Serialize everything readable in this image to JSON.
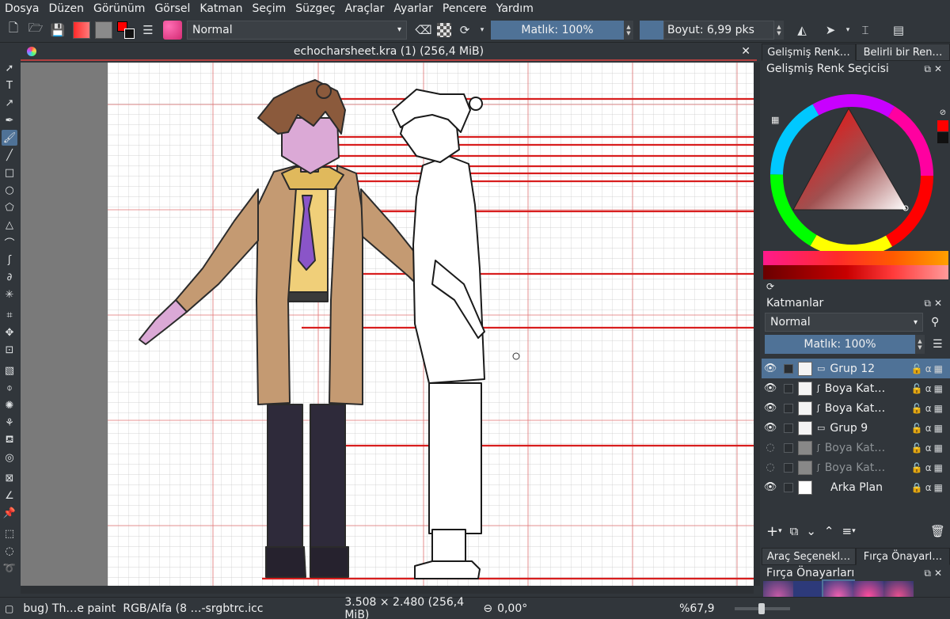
{
  "menu": [
    "Dosya",
    "Düzen",
    "Görünüm",
    "Görsel",
    "Katman",
    "Seçim",
    "Süzgeç",
    "Araçlar",
    "Ayarlar",
    "Pencere",
    "Yardım"
  ],
  "toolbar": {
    "blend_mode": "Normal",
    "opacity": "Matlık: 100%",
    "size": "Boyut: 6,99 pks"
  },
  "document": {
    "tab_title": "echocharsheet.kra (1) (256,4 MiB)"
  },
  "docker": {
    "top_tabs": [
      "Gelişmiş Renk…",
      "Belirli bir Ren…"
    ],
    "color_title": "Gelişmiş Renk Seçicisi",
    "layers_title": "Katmanlar",
    "layer_blend": "Normal",
    "layer_opacity": "Matlık:  100%",
    "layers": [
      {
        "name": "Grup 12",
        "visible": true,
        "selected": true,
        "dim": false
      },
      {
        "name": "Boya Kat…",
        "visible": true,
        "selected": false,
        "dim": false
      },
      {
        "name": "Boya Kat…",
        "visible": true,
        "selected": false,
        "dim": false
      },
      {
        "name": "Grup 9",
        "visible": true,
        "selected": false,
        "dim": false
      },
      {
        "name": "Boya Kat…",
        "visible": false,
        "selected": false,
        "dim": true
      },
      {
        "name": "Boya Kat…",
        "visible": false,
        "selected": false,
        "dim": true
      },
      {
        "name": "Arka Plan",
        "visible": true,
        "selected": false,
        "dim": false
      }
    ],
    "bottom_tabs": [
      "Araç Seçenekl…",
      "Fırça Önayarl…"
    ],
    "presets_title": "Fırça Önayarları"
  },
  "status": {
    "brush": "bug) Th…e paint",
    "color_space": "RGB/Alfa (8 …-srgbtrc.icc",
    "image_size": "3.508 × 2.480 (256,4 MiB)",
    "rotation": "0,00°",
    "zoom": "%67,9"
  },
  "colors": {
    "accent": "#4f7297",
    "fg": "#ff0000",
    "guide": "#e04a4a"
  }
}
